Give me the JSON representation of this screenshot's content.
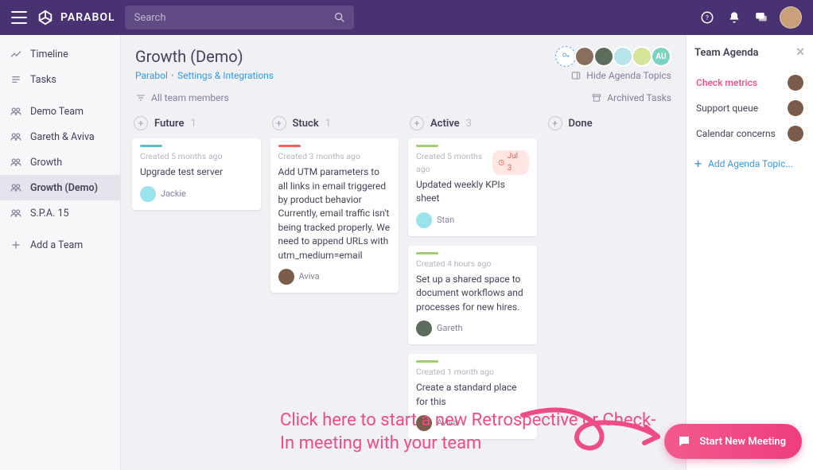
{
  "brand": "PARABOL",
  "search": {
    "placeholder": "Search"
  },
  "nav": {
    "timeline": "Timeline",
    "tasks": "Tasks",
    "teams": [
      "Demo Team",
      "Gareth & Aviva",
      "Growth",
      "Growth (Demo)",
      "S.P.A. 15"
    ],
    "add_team": "Add a Team",
    "active_index": 3
  },
  "page": {
    "title": "Growth (Demo)",
    "crumb_root": "Parabol",
    "crumb_current": "Settings & Integrations",
    "hide_agenda": "Hide Agenda Topics",
    "filter": "All team members",
    "archived": "Archived Tasks",
    "members": {
      "extra_label": "AU"
    }
  },
  "columns": [
    {
      "title": "Future",
      "count": "1",
      "stripe": "teal",
      "cards": [
        {
          "meta": "Created 5 months ago",
          "text": "Upgrade test server",
          "assignee": "Jackie",
          "ava": "ava-teal"
        }
      ]
    },
    {
      "title": "Stuck",
      "count": "1",
      "stripe": "red",
      "cards": [
        {
          "meta": "Created 3 months ago",
          "text": "Add UTM parameters to all links in email triggered by product behavior Currently, email traffic isn't being tracked properly. We need to append URLs with utm_medium=email",
          "assignee": "Aviva",
          "ava": "ava-b"
        }
      ]
    },
    {
      "title": "Active",
      "count": "3",
      "stripe": "lime",
      "cards": [
        {
          "meta": "Created 5 months ago",
          "due": "Jul 3",
          "text": "Updated weekly KPIs sheet",
          "assignee": "Stan",
          "ava": "ava-teal"
        },
        {
          "meta": "Created 4 hours ago",
          "text": "Set up a shared space to document workflows and processes for new hires.",
          "assignee": "Gareth",
          "ava": "ava-c"
        },
        {
          "meta": "Created 1 month ago",
          "text": "Create a standard place for this",
          "assignee": "Aviva",
          "ava": "ava-b"
        }
      ]
    },
    {
      "title": "Done",
      "count": "",
      "stripe": "",
      "cards": []
    }
  ],
  "annotation": "Click here to start a new Retrospective or Check-In meeting with your team",
  "agenda": {
    "title": "Team Agenda",
    "items": [
      {
        "label": "Check metrics",
        "active": true
      },
      {
        "label": "Support queue",
        "active": false
      },
      {
        "label": "Calendar concerns",
        "active": false
      }
    ],
    "add": "Add Agenda Topic..."
  },
  "fab": "Start New Meeting"
}
